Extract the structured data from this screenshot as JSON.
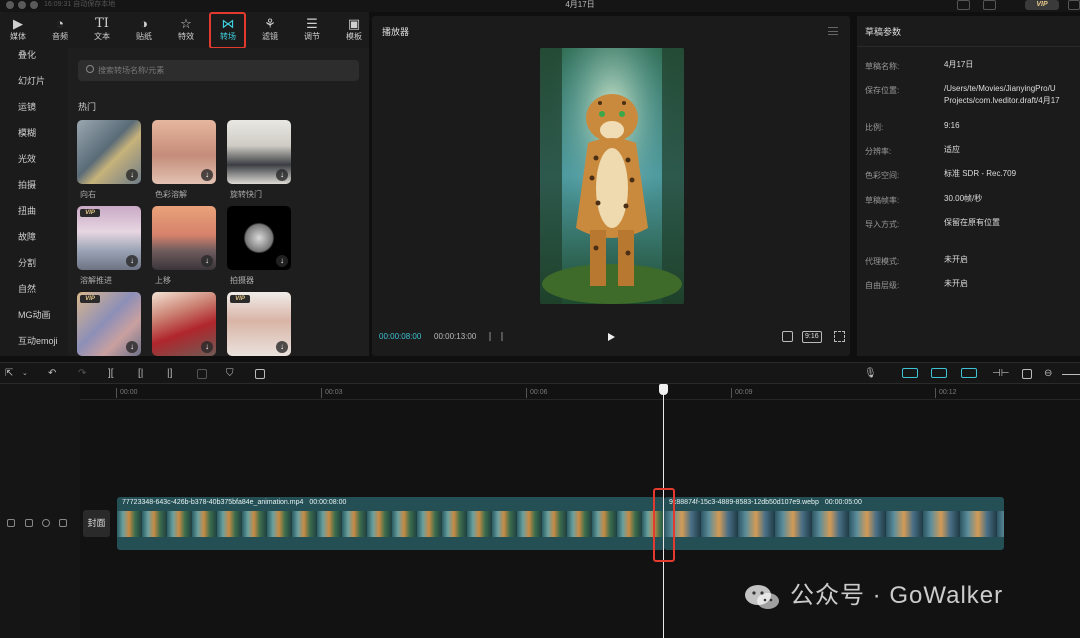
{
  "titlebar": {
    "status": "16:09:31 自动保存本地",
    "window_title": "4月17日",
    "vip_label": "VIP"
  },
  "toolbar": {
    "tools": [
      {
        "icon": "media-icon",
        "label": "媒体"
      },
      {
        "icon": "audio-icon",
        "label": "音频"
      },
      {
        "icon": "text-icon",
        "label": "文本"
      },
      {
        "icon": "sticker-icon",
        "label": "贴纸"
      },
      {
        "icon": "effects-icon",
        "label": "特效"
      },
      {
        "icon": "transition-icon",
        "label": "转场"
      },
      {
        "icon": "filter-icon",
        "label": "滤镜"
      },
      {
        "icon": "adjust-icon",
        "label": "调节"
      },
      {
        "icon": "template-icon",
        "label": "模板"
      }
    ],
    "active": "转场",
    "accent_color": "#3fd3e0"
  },
  "categories": [
    "叠化",
    "幻灯片",
    "运镜",
    "模糊",
    "光效",
    "拍摄",
    "扭曲",
    "故障",
    "分割",
    "自然",
    "MG动画",
    "互动emoji"
  ],
  "search": {
    "placeholder": "搜索转场名称/元素"
  },
  "section_label": "热门",
  "transitions": [
    {
      "label": "向右",
      "vip": false
    },
    {
      "label": "色彩溶解",
      "vip": false
    },
    {
      "label": "旋转快门",
      "vip": false
    },
    {
      "label": "溶解推进",
      "vip": true
    },
    {
      "label": "上移",
      "vip": false
    },
    {
      "label": "拍摄器",
      "vip": false
    },
    {
      "label": "",
      "vip": true
    },
    {
      "label": "",
      "vip": false
    },
    {
      "label": "",
      "vip": true
    }
  ],
  "vip_badge": "VIP",
  "player": {
    "title": "播放器",
    "current_time": "00:00:08:00",
    "total_time": "00:00:13:00",
    "ratio": "9:16"
  },
  "params": {
    "title": "草稿参数",
    "rows": [
      {
        "label": "草稿名称:",
        "value": "4月17日"
      },
      {
        "label": "保存位置:",
        "value": "/Users/te/Movies/JianyingPro/U",
        "value2": "Projects/com.lveditor.draft/4月17"
      },
      {
        "label": "比例:",
        "value": "9:16"
      },
      {
        "label": "分辨率:",
        "value": "适应"
      },
      {
        "label": "色彩空间:",
        "value": "标准 SDR - Rec.709"
      },
      {
        "label": "草稿帧率:",
        "value": "30.00帧/秒"
      },
      {
        "label": "导入方式:",
        "value": "保留在原有位置"
      },
      {
        "label": "代理模式:",
        "value": "未开启"
      },
      {
        "label": "自由层级:",
        "value": "未开启"
      }
    ]
  },
  "timeline": {
    "ruler_ticks": [
      "00:00",
      "00:03",
      "00:06",
      "00:09",
      "00:12"
    ],
    "cover_label": "封面",
    "clips": [
      {
        "name": "77723348-643c-426b-b378-40b375bfa84e_animation.mp4",
        "duration": "00:00:08:00"
      },
      {
        "name": "9c88874f-15c3-4889-8583-12db50d107e9.webp",
        "duration": "00:00:05:00"
      }
    ],
    "playhead_time": "00:00:08:00"
  },
  "watermark": {
    "text": "公众号 · GoWalker"
  }
}
